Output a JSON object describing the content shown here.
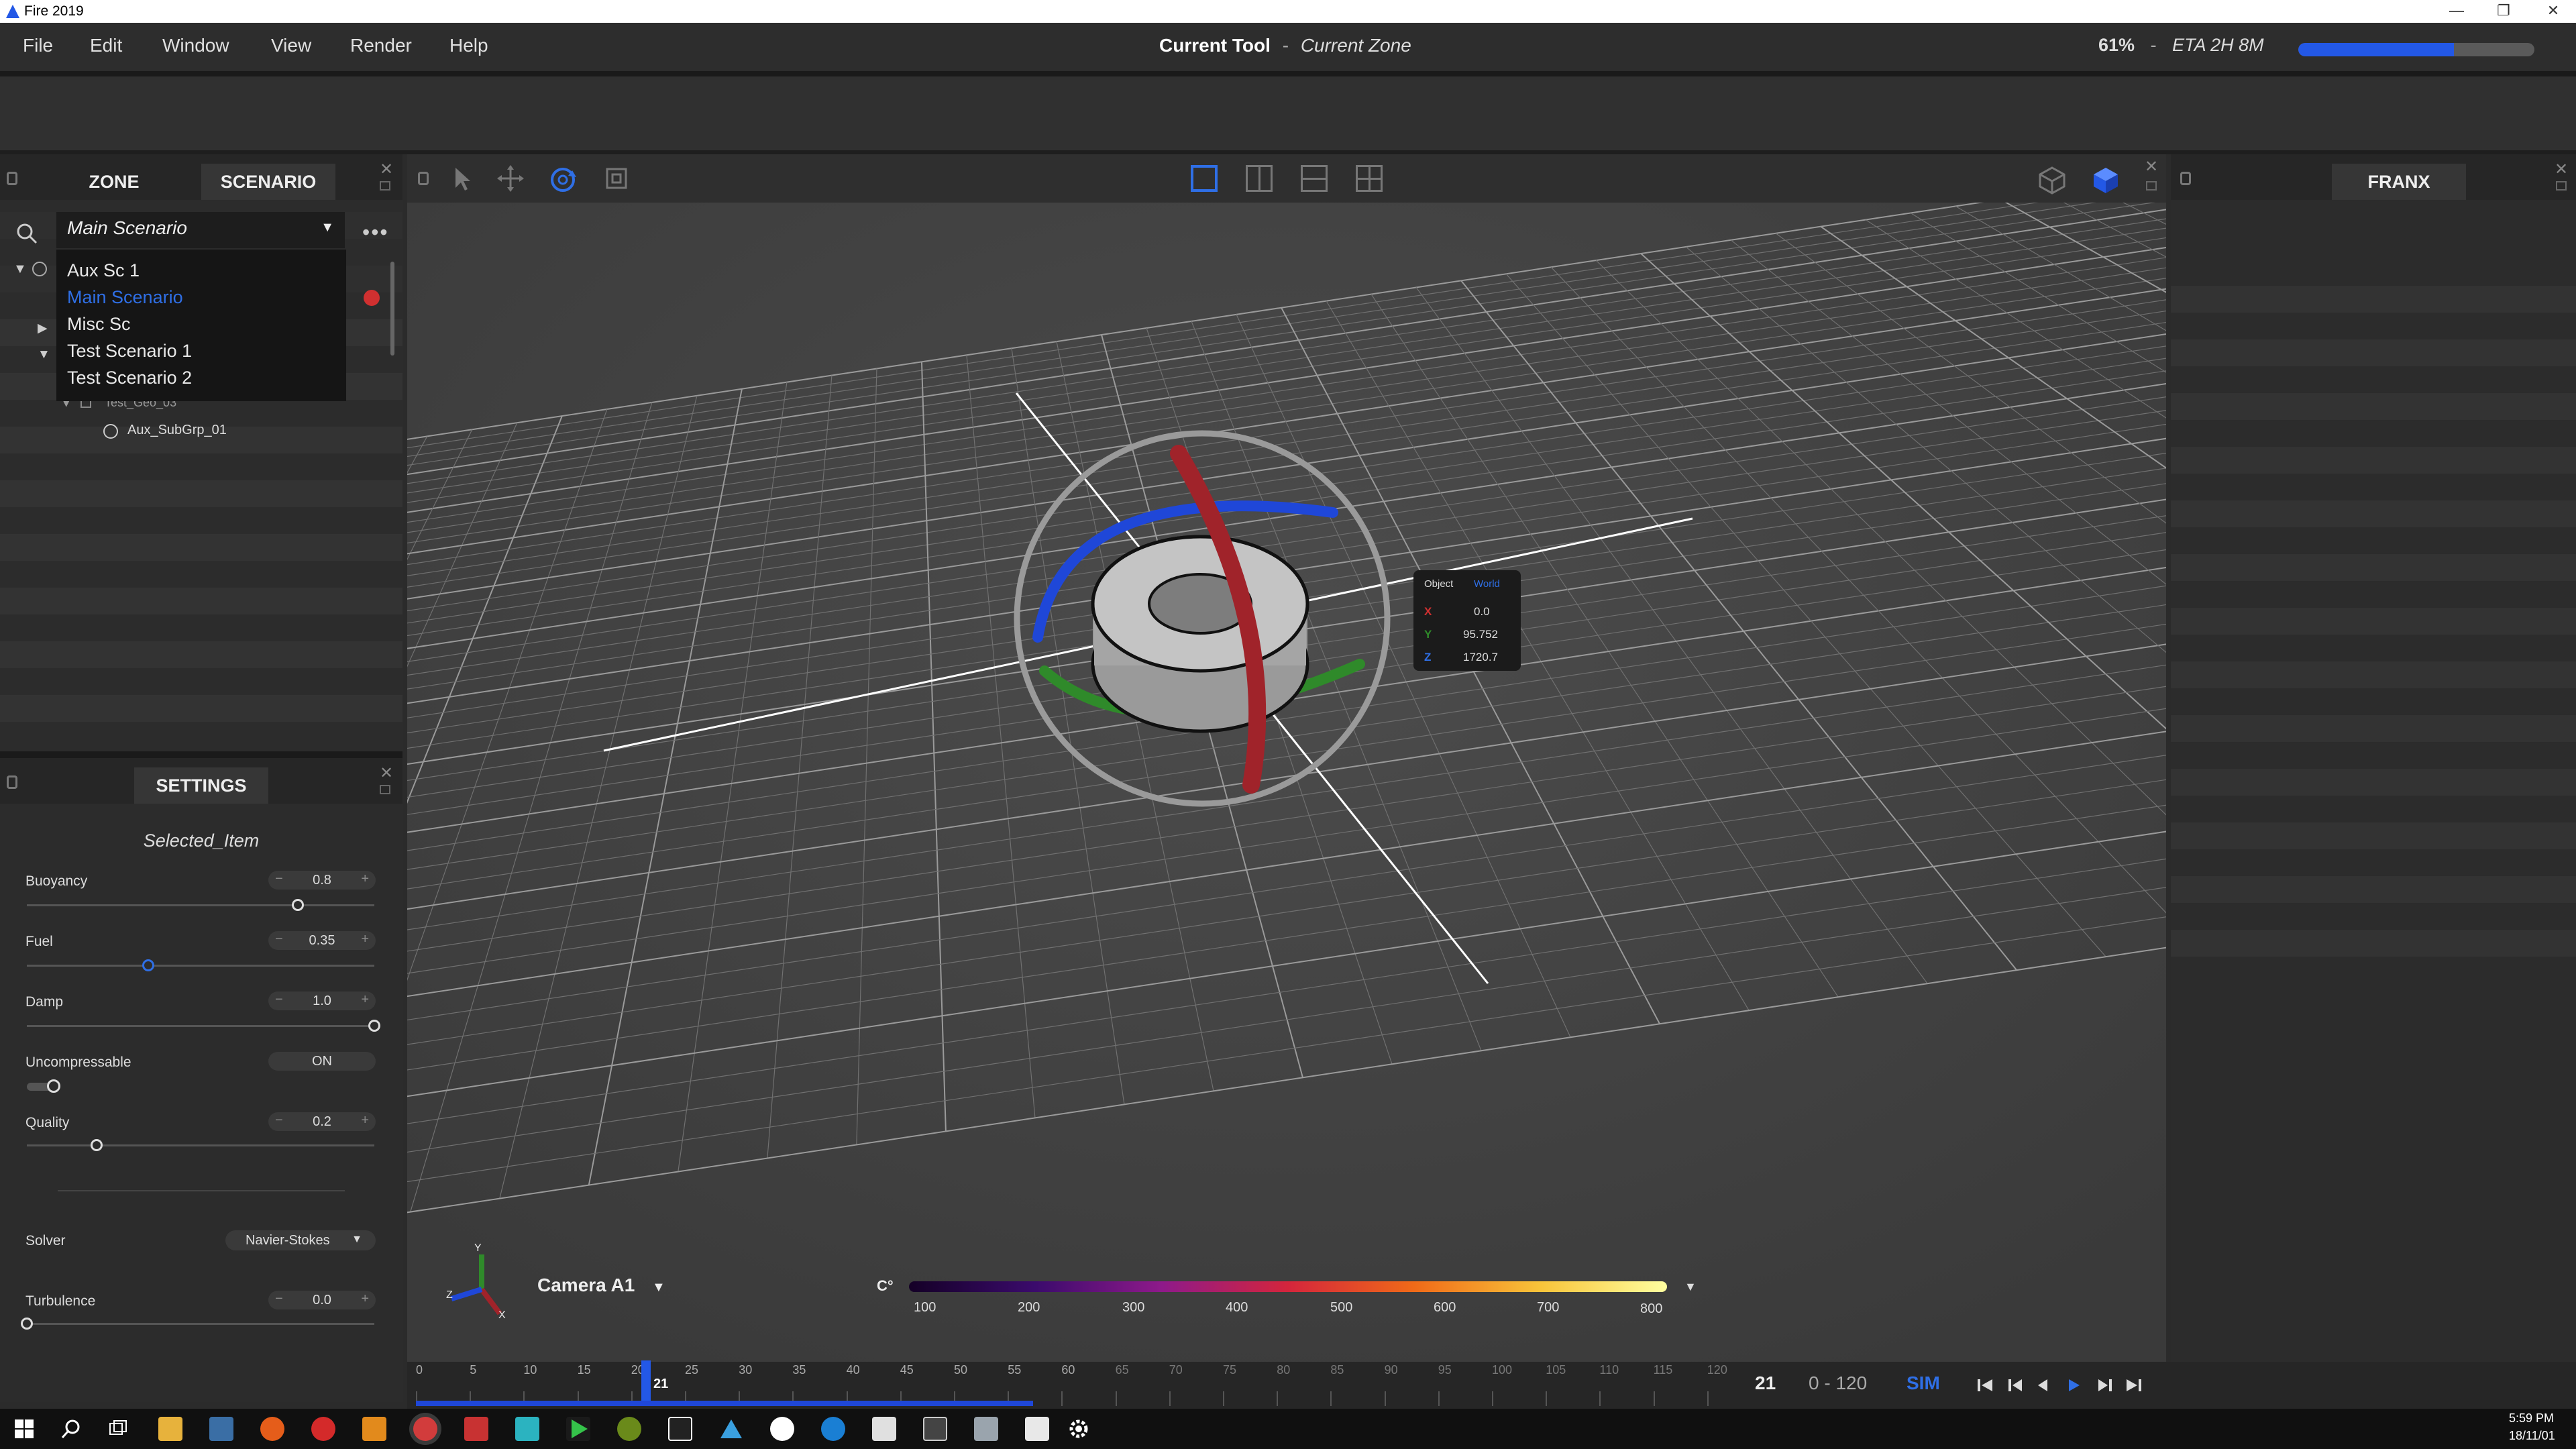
{
  "app": {
    "title": "Fire 2019"
  },
  "window_controls": {
    "minimize": "—",
    "restore": "❐",
    "close": "✕"
  },
  "menu": [
    "File",
    "Edit",
    "Window",
    "View",
    "Render",
    "Help"
  ],
  "header": {
    "current_tool": "Current Tool",
    "separator": "-",
    "current_zone": "Current Zone"
  },
  "progress": {
    "percent_label": "61%",
    "separator": "-",
    "eta": "ETA 2H 8M",
    "fraction": 0.66
  },
  "left_panel": {
    "tabs": [
      "ZONE",
      "SCENARIO"
    ],
    "active_tab": "SCENARIO",
    "dropdown_value": "Main Scenario",
    "dropdown_items": [
      "Aux Sc 1",
      "Main Scenario",
      "Misc Sc",
      "Test Scenario 1",
      "Test Scenario 2"
    ],
    "selected_item": "Main Scenario",
    "tree_items": [
      "Test_Geo_03",
      "Aux_SubGrp_01"
    ]
  },
  "settings": {
    "tab": "SETTINGS",
    "selected_item": "Selected_Item",
    "params": [
      {
        "label": "Buoyancy",
        "value": "0.8",
        "fraction": 0.78
      },
      {
        "label": "Fuel",
        "value": "0.35",
        "fraction": 0.35
      },
      {
        "label": "Damp",
        "value": "1.0",
        "fraction": 1.0
      }
    ],
    "toggle": {
      "label": "Uncompressable",
      "value": "ON"
    },
    "quality": {
      "label": "Quality",
      "value": "0.2",
      "fraction": 0.2
    },
    "solver": {
      "label": "Solver",
      "value": "Navier-Stokes"
    },
    "turbulence": {
      "label": "Turbulence",
      "value": "0.0",
      "fraction": 0.0
    },
    "minus": "−",
    "plus": "+"
  },
  "viewport": {
    "coord_tooltip": {
      "mode_object": "Object",
      "mode_world": "World",
      "x_label": "X",
      "x": "0.0",
      "y_label": "Y",
      "y": "95.752",
      "z_label": "Z",
      "z": "1720.7"
    },
    "camera": "Camera A1",
    "temp_unit": "C°",
    "temp_ticks": [
      "100",
      "200",
      "300",
      "400",
      "500",
      "600",
      "700",
      "800"
    ],
    "axis_labels": {
      "x": "X",
      "y": "Y",
      "z": "Z"
    }
  },
  "right_panel": {
    "tab": "FRANX"
  },
  "timeline": {
    "ticks": [
      "0",
      "5",
      "10",
      "15",
      "20",
      "25",
      "30",
      "35",
      "40",
      "45",
      "50",
      "55",
      "60",
      "65",
      "70",
      "75",
      "80",
      "85",
      "90",
      "95",
      "100",
      "105",
      "110",
      "115",
      "120"
    ],
    "current_frame": "21",
    "frame_display": "21",
    "range": "0 - 120",
    "mode": "SIM"
  },
  "clock": {
    "time": "5:59 PM",
    "date": "18/11/01"
  },
  "colors": {
    "accent": "#2358e6",
    "selected_text": "#2f6fe6",
    "record": "#d03030"
  }
}
